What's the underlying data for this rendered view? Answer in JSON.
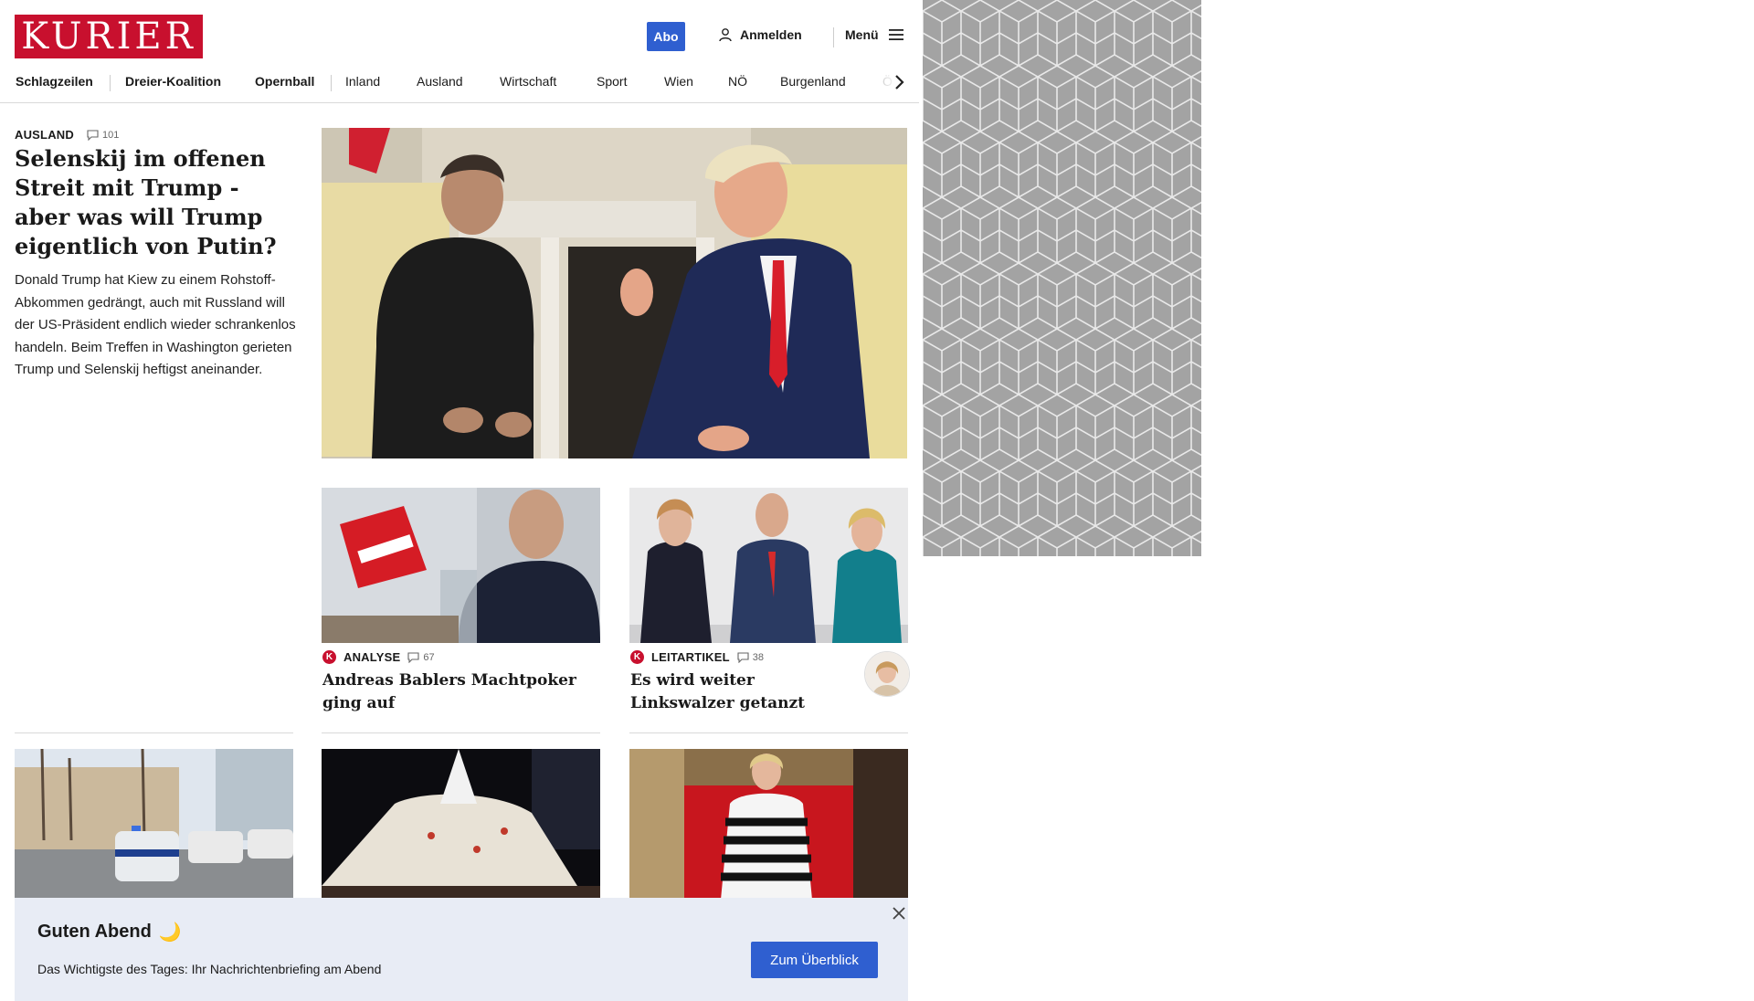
{
  "header": {
    "logo_text": "KURIER",
    "abo_label": "Abo",
    "login_label": "Anmelden",
    "menu_label": "Menü"
  },
  "nav": {
    "items": [
      "Schlagzeilen",
      "Dreier-Koalition",
      "Opernball",
      "Inland",
      "Ausland",
      "Wirtschaft",
      "Sport",
      "Wien",
      "NÖ",
      "Burgenland",
      "Ö"
    ]
  },
  "lead": {
    "kicker": "AUSLAND",
    "comments": "101",
    "title": "Selenskij im offenen Streit mit Trump - aber was will Trump eigentlich von Putin?",
    "teaser": "Donald Trump hat Kiew zu einem Rohstoff-Abkommen gedrängt, auch mit Russland will der US-Präsident endlich wieder schrankenlos handeln. Beim Treffen in Washington gerieten Trump und Selenskij heftigst aneinander."
  },
  "cards": [
    {
      "badge": "K",
      "kicker": "ANALYSE",
      "comments": "67",
      "title": "Andreas Bablers Machtpoker ging auf"
    },
    {
      "badge": "K",
      "kicker": "LEITARTIKEL",
      "comments": "38",
      "title": "Es wird weiter Linkswalzer getanzt"
    }
  ],
  "briefing": {
    "title": "Guten Abend",
    "emoji": "🌙",
    "text": "Das Wichtigste des Tages: Ihr Nachrichtenbriefing am Abend",
    "button": "Zum Überblick"
  },
  "colors": {
    "brand_red": "#c8102e",
    "accent_blue": "#2f5fd0",
    "briefing_bg": "#e8ecf5"
  }
}
